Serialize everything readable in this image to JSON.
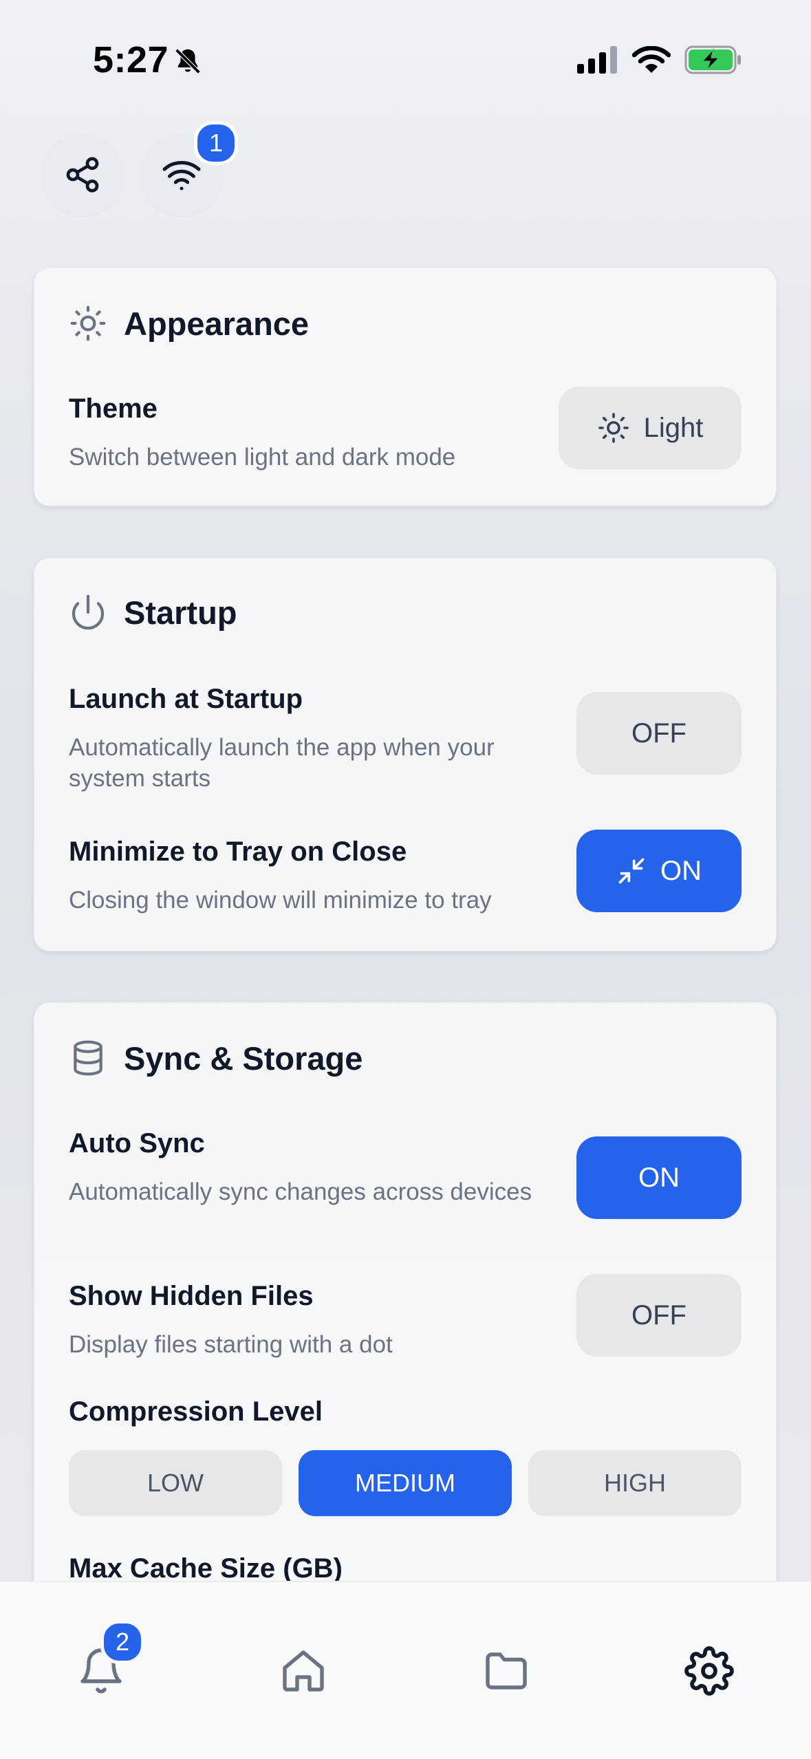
{
  "status_bar": {
    "time": "5:27"
  },
  "top_actions": {
    "wifi_badge": "1"
  },
  "appearance": {
    "title": "Appearance",
    "theme_title": "Theme",
    "theme_desc": "Switch between light and dark mode",
    "theme_value": "Light"
  },
  "startup": {
    "title": "Startup",
    "launch_title": "Launch at Startup",
    "launch_desc": "Automatically launch the app when your system starts",
    "launch_value": "OFF",
    "minimize_title": "Minimize to Tray on Close",
    "minimize_desc": "Closing the window will minimize to tray",
    "minimize_value": "ON"
  },
  "sync": {
    "title": "Sync & Storage",
    "auto_sync_title": "Auto Sync",
    "auto_sync_desc": "Automatically sync changes across devices",
    "auto_sync_value": "ON",
    "hidden_files_title": "Show Hidden Files",
    "hidden_files_desc": "Display files starting with a dot",
    "hidden_files_value": "OFF",
    "compression_title": "Compression Level",
    "compression_options": [
      "LOW",
      "MEDIUM",
      "HIGH"
    ],
    "compression_selected": "MEDIUM",
    "cache_title": "Max Cache Size (GB)"
  },
  "bottom_nav": {
    "notifications_badge": "2",
    "items": [
      "bell-icon",
      "home-icon",
      "folder-icon",
      "gear-icon"
    ],
    "active": "gear-icon"
  },
  "colors": {
    "accent": "#2563eb",
    "toggle_off": "#e5e7eb",
    "muted_text": "#6b7280",
    "battery_green": "#34c759"
  }
}
